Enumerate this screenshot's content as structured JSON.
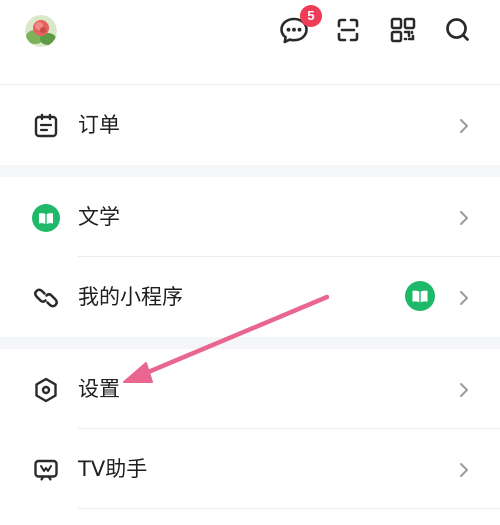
{
  "header": {
    "avatar_icon": "user-avatar",
    "chat_badge_count": "5",
    "icons": [
      "chat-bubble-icon",
      "scan-icon",
      "qr-code-icon",
      "search-icon"
    ]
  },
  "menu": {
    "order": {
      "label": "订单",
      "icon": "order-icon"
    },
    "literature": {
      "label": "文学",
      "icon": "book-icon"
    },
    "mini_programs": {
      "label": "我的小程序",
      "icon": "link-icon",
      "badge_icon": "book-icon"
    },
    "settings": {
      "label": "设置",
      "icon": "hexagon-settings-icon"
    },
    "tv_assistant": {
      "label": "TV助手",
      "icon": "tv-icon"
    }
  },
  "colors": {
    "badge_red": "#ee3b57",
    "brand_green": "#1fb96a",
    "arrow_pink": "#e8668f",
    "separator": "#f5f6fa"
  }
}
